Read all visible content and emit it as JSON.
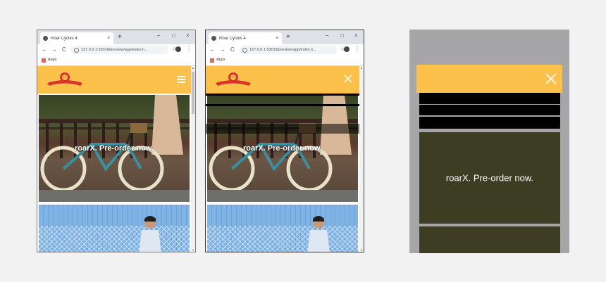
{
  "browser_window_1": {
    "tab_title": "Roar Cycles 4",
    "new_tab": "+",
    "url": "127.0.0.1:53018/preview/app/index.h...",
    "bookmarks_label": "Apps",
    "hero_text": "roarX. Pre-order now."
  },
  "browser_window_2": {
    "tab_title": "Roar Cycles 4",
    "new_tab": "+",
    "url": "127.0.0.1:53018/preview/app/index.h...",
    "bookmarks_label": "Apps",
    "hero_text": "roarX. Pre-order now."
  },
  "wireframe": {
    "panel_text": "roarX. Pre-order now."
  },
  "window_controls": {
    "minimize": "–",
    "maximize": "□",
    "close": "×"
  },
  "nav": {
    "back": "←",
    "forward": "→",
    "reload": "C",
    "star": "☆",
    "menu": "⋮",
    "tab_close": "×"
  },
  "colors": {
    "brand_yellow": "#fbc14b",
    "brand_red": "#d9332b",
    "menu_black": "#000000",
    "panel_olive": "#3d3d24",
    "wireframe_gray": "#a6a6a8"
  }
}
